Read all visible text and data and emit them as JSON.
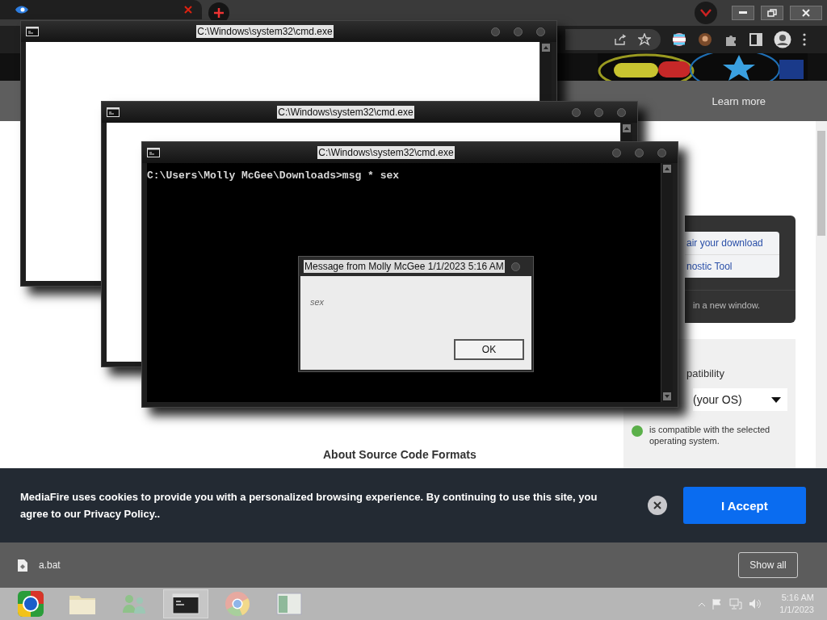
{
  "info_bar": {
    "link": "Learn more"
  },
  "download_panel": {
    "links": [
      "air your download",
      "nostic Tool"
    ],
    "note": "in a new window."
  },
  "compatibility": {
    "heading": "patibility",
    "select_value": "(your OS)",
    "status": "is compatible with the selected operating system."
  },
  "section_heading": "About Source Code Formats",
  "cookie_banner": {
    "message": "MediaFire uses cookies to provide you with a personalized browsing experience. By continuing to use this site, you agree to our Privacy Policy..",
    "button": "I Accept"
  },
  "downloads_bar": {
    "file": "a.bat",
    "button": "Show all"
  },
  "windows": [
    {
      "title": "C:\\Windows\\system32\\cmd.exe",
      "kind": "blank"
    },
    {
      "title": "C:\\Windows\\system32\\cmd.exe",
      "kind": "blank"
    },
    {
      "title": "C:\\Windows\\system32\\cmd.exe",
      "kind": "console",
      "lines": [
        "C:\\Users\\Molly McGee\\Downloads>msg * sex"
      ]
    }
  ],
  "message_box": {
    "title": "Message from Molly McGee 1/1/2023 5:16 AM",
    "message": "sex",
    "button": "OK"
  },
  "taskbar": {
    "apps": [
      {
        "kind": "ball",
        "selected": false
      },
      {
        "kind": "folder",
        "selected": false
      },
      {
        "kind": "people",
        "selected": false
      },
      {
        "kind": "console",
        "selected": true
      },
      {
        "kind": "chrome",
        "selected": false
      },
      {
        "kind": "window",
        "selected": false
      }
    ],
    "time": "5:16 AM",
    "date": "1/1/2023"
  }
}
